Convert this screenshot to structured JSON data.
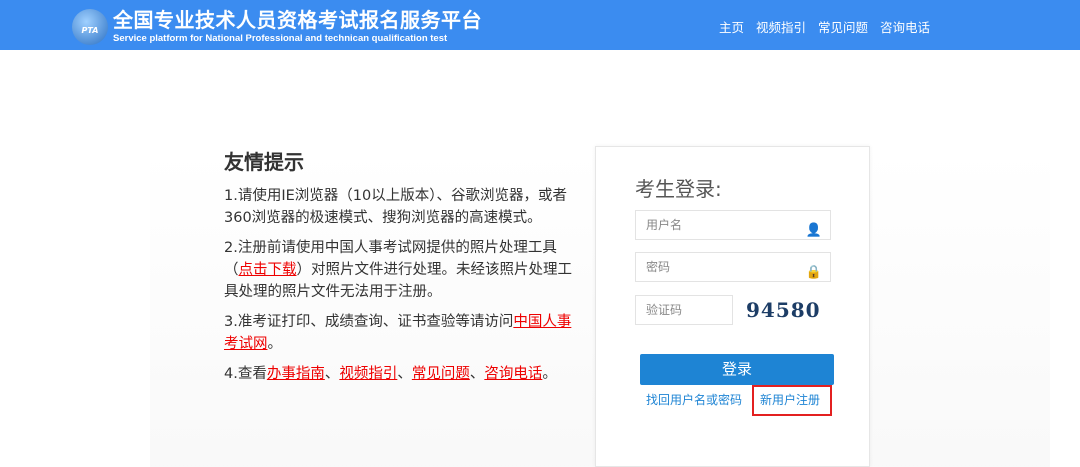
{
  "header": {
    "logo_text": "PTA",
    "title": "全国专业技术人员资格考试报名服务平台",
    "subtitle": "Service platform for National Professional and technican qualification test",
    "nav": [
      "主页",
      "视频指引",
      "常见问题",
      "咨询电话"
    ]
  },
  "tips": {
    "heading": "友情提示",
    "item1": "1.请使用IE浏览器（10以上版本）、谷歌浏览器，或者360浏览器的极速模式、搜狗浏览器的高速模式。",
    "item2_a": "2.注册前请使用中国人事考试网提供的照片处理工具（",
    "item2_link": "点击下载",
    "item2_b": "）对照片文件进行处理。未经该照片处理工具处理的照片文件无法用于注册。",
    "item3_a": "3.准考证打印、成绩查询、证书查验等请访问",
    "item3_link": "中国人事考试网",
    "item3_b": "。",
    "item4_a": "4.查看",
    "item4_links": [
      "办事指南",
      "视频指引",
      "常见问题",
      "咨询电话"
    ],
    "item4_sep": "、",
    "item4_end": "。"
  },
  "login": {
    "title": "考生登录:",
    "username_placeholder": "用户名",
    "password_placeholder": "密码",
    "captcha_placeholder": "验证码",
    "captcha_text": "94580",
    "submit": "登录",
    "forgot": "找回用户名或密码",
    "register": "新用户注册"
  },
  "colors": {
    "header": "#3b8cf0",
    "button": "#1e84d4",
    "link_red": "#e00000",
    "highlight": "#e32020"
  }
}
